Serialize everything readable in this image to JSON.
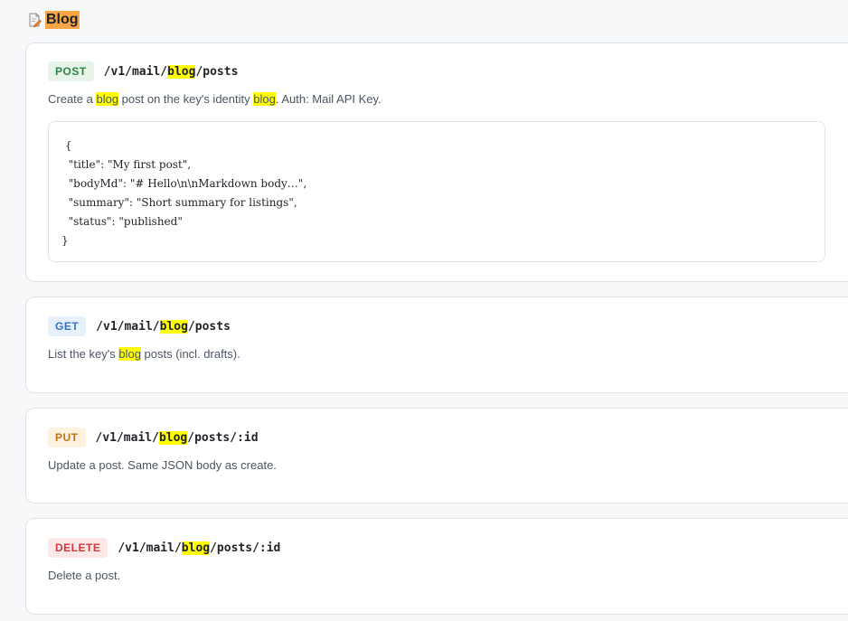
{
  "section": {
    "icon": "document-edit-icon",
    "title": "Blog"
  },
  "endpoints": [
    {
      "method": "POST",
      "path_prefix": "/v1/mail/",
      "path_highlight": "blog",
      "path_suffix": "/posts",
      "desc_parts": [
        "Create a ",
        "blog",
        " post on the key's identity ",
        "blog",
        ". Auth: Mail API Key."
      ],
      "code_lines": [
        " {",
        "  \"title\": \"My first post\",",
        "  \"bodyMd\": \"# Hello\\n\\nMarkdown body…\",",
        "  \"summary\": \"Short summary for listings\",",
        "  \"status\": \"published\"",
        "}"
      ]
    },
    {
      "method": "GET",
      "path_prefix": "/v1/mail/",
      "path_highlight": "blog",
      "path_suffix": "/posts",
      "desc_parts": [
        "List the key's ",
        "blog",
        " posts (incl. drafts)."
      ]
    },
    {
      "method": "PUT",
      "path_prefix": "/v1/mail/",
      "path_highlight": "blog",
      "path_suffix": "/posts/:id",
      "desc": "Update a post. Same JSON body as create."
    },
    {
      "method": "DELETE",
      "path_prefix": "/v1/mail/",
      "path_highlight": "blog",
      "path_suffix": "/posts/:id",
      "desc": "Delete a post."
    }
  ],
  "colors": {
    "post": "#2e8540",
    "get": "#3572c6",
    "put": "#c1731b",
    "delete": "#d1393a",
    "highlight": "#ffff00",
    "section_highlight": "#f7a545"
  }
}
